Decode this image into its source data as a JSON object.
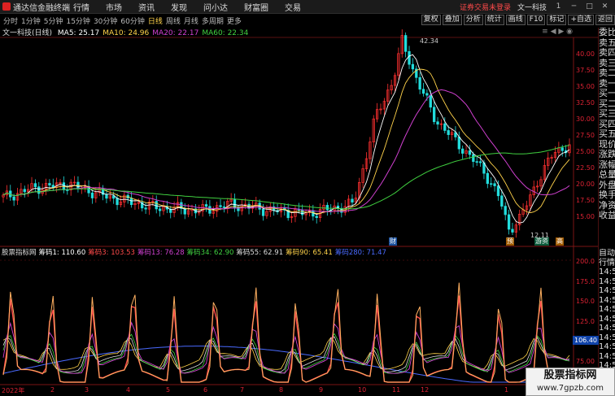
{
  "app": {
    "title": "通达信金融终端",
    "menu": [
      "行情",
      "市场",
      "资讯",
      "发现",
      "问小达",
      "财富圈",
      "交易"
    ],
    "notice": "证券交易未登录",
    "stock_header": "文一科技",
    "window_controls": [
      "1",
      "─",
      "□",
      "✕"
    ]
  },
  "periodbar": {
    "periods": [
      "分时",
      "1分钟",
      "5分钟",
      "15分钟",
      "30分钟",
      "60分钟",
      "日线",
      "周线",
      "月线",
      "多周期",
      "更多"
    ],
    "selected_index": 6,
    "tools": [
      "复权",
      "叠加",
      "分析",
      "统计",
      "画线",
      "F10",
      "标记",
      "+自选",
      "返回"
    ]
  },
  "ma_legend": {
    "name": "文一科技(日线)",
    "items": [
      {
        "label": "MA5: 25.17",
        "color": "#ffffff"
      },
      {
        "label": "MA10: 24.96",
        "color": "#ffd24a"
      },
      {
        "label": "MA20: 22.17",
        "color": "#d040d0"
      },
      {
        "label": "MA60: 22.34",
        "color": "#40d040"
      }
    ],
    "window_icons": "≡ ◀ ▶ ◉"
  },
  "price_axis": {
    "ticks": [
      "40.00",
      "37.50",
      "35.00",
      "32.50",
      "30.00",
      "27.50",
      "25.00",
      "22.50",
      "20.00",
      "17.50",
      "15.00"
    ],
    "high_label": "42.34",
    "low_label": "12.11"
  },
  "markers": [
    {
      "text": "财",
      "color": "#ffffff",
      "bg": "#1a4f9a"
    },
    {
      "text": "预",
      "color": "#ffffff",
      "bg": "#a05a00"
    },
    {
      "text": "游资",
      "color": "#ffffff",
      "bg": "#0a5a3a"
    },
    {
      "text": "高",
      "color": "#ffffff",
      "bg": "#a05a00"
    }
  ],
  "side_panel": [
    "委比",
    "卖五",
    "卖四",
    "卖三",
    "卖二",
    "卖一",
    "买一",
    "买二",
    "买三",
    "买四",
    "买五",
    "现价",
    "涨跌",
    "涨幅",
    "总量",
    "外盘",
    "换手",
    "净资",
    "收益"
  ],
  "side_panel2": [
    "自动",
    "行情",
    "14:5",
    "14:5",
    "14:5",
    "14:5",
    "14:5",
    "14:5",
    "14:5",
    "14:5",
    "14:5",
    "14:5",
    "14:5",
    "14:5"
  ],
  "indicator_legend": [
    {
      "label": "股票指标网",
      "color": "#dddddd"
    },
    {
      "label": "筹码1: 110.60",
      "color": "#ffffff"
    },
    {
      "label": "筹码3: 103.53",
      "color": "#ff4a4a"
    },
    {
      "label": "筹码13: 76.28",
      "color": "#d040d0"
    },
    {
      "label": "筹码34: 62.90",
      "color": "#40d040"
    },
    {
      "label": "筹码55: 62.91",
      "color": "#dddddd"
    },
    {
      "label": "筹码90: 65.41",
      "color": "#ffd24a"
    },
    {
      "label": "筹码280: 71.47",
      "color": "#4a6aff"
    }
  ],
  "indicator_axis": {
    "ticks": [
      "200.0",
      "175.0",
      "150.0",
      "125.0",
      "100.0",
      "75.00",
      "50.00",
      "25.00"
    ],
    "current_value": "106.40"
  },
  "date_axis": [
    "2022年",
    "2",
    "3",
    "4",
    "5",
    "6",
    "7",
    "8",
    "9",
    "10",
    "11",
    "12",
    "1",
    "2"
  ],
  "watermark": {
    "line1": "股票指标网",
    "line2": "www.7gpzb.com"
  },
  "colors": {
    "bg": "#000000",
    "axis": "#dd2233",
    "ma5": "#ffffff",
    "ma10": "#ffd24a",
    "ma20": "#d040d0",
    "ma60": "#40d040",
    "up": "#ff3030",
    "down": "#22dddd"
  }
}
